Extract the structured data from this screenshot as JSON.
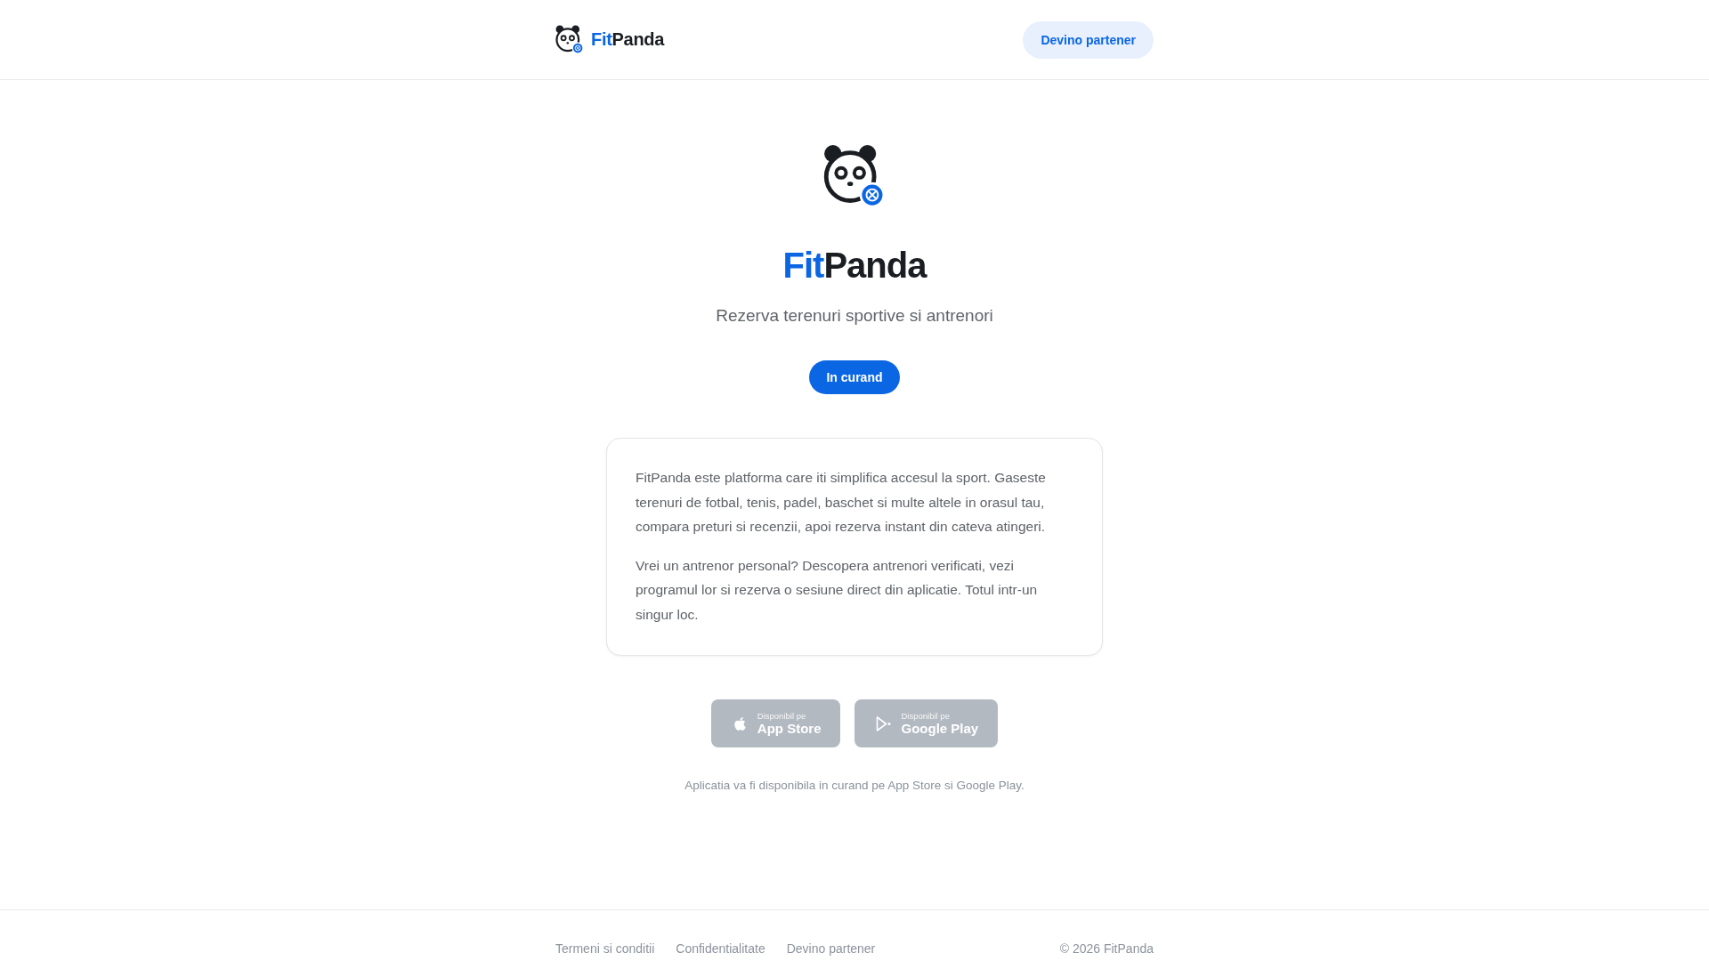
{
  "header": {
    "logo": {
      "accent": "Fit",
      "rest": "Panda"
    },
    "partner_button": "Devino partener"
  },
  "hero": {
    "title": {
      "accent": "Fit",
      "rest": "Panda"
    },
    "tagline": "Rezerva terenuri sportive si antrenori",
    "status_badge": "In curand"
  },
  "about_card": {
    "paragraphs": [
      "FitPanda este platforma care iti simplifica accesul la sport. Gaseste terenuri de fotbal, tenis, padel, baschet si multe altele in orasul tau, compara preturi si recenzii, apoi rezerva instant din cateva atingeri.",
      "Vrei un antrenor personal? Descopera antrenori verificati, vezi programul lor si rezerva o sesiune direct din aplicatie. Totul intr-un singur loc."
    ]
  },
  "store_buttons": [
    {
      "kind": "apple",
      "caption": "Disponibil pe",
      "store": "App Store",
      "disabled": true
    },
    {
      "kind": "google_play",
      "caption": "Disponibil pe",
      "store": "Google Play",
      "disabled": true
    }
  ],
  "availability_note": "Aplicatia va fi disponibila in curand pe App Store si Google Play.",
  "footer": {
    "links": [
      "Termeni si conditii",
      "Confidentialitate",
      "Devino partener"
    ],
    "copyright": "© 2026 FitPanda"
  }
}
